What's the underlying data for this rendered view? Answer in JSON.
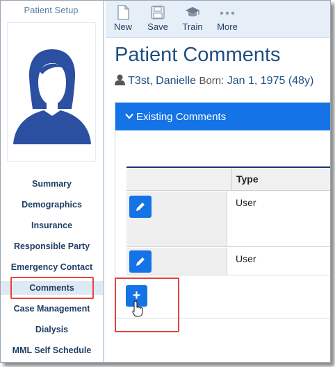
{
  "sidebar": {
    "title": "Patient Setup",
    "items": [
      {
        "label": "Summary"
      },
      {
        "label": "Demographics"
      },
      {
        "label": "Insurance"
      },
      {
        "label": "Responsible Party"
      },
      {
        "label": "Emergency Contact"
      },
      {
        "label": "Comments",
        "active": true
      },
      {
        "label": "Case Management"
      },
      {
        "label": "Dialysis"
      },
      {
        "label": "MML Self Schedule"
      }
    ]
  },
  "toolbar": {
    "new_label": "New",
    "save_label": "Save",
    "train_label": "Train",
    "more_label": "More"
  },
  "page": {
    "title": "Patient Comments"
  },
  "patient": {
    "name": "T3st, Danielle",
    "born_label": "Born:",
    "born_value": "Jan 1, 1975 (48y)"
  },
  "panel": {
    "header": "Existing Comments",
    "columns": {
      "type": "Type"
    },
    "rows": [
      {
        "type": "User"
      },
      {
        "type": "User"
      }
    ],
    "add_label": "+"
  },
  "colors": {
    "accent": "#1473e6",
    "highlight": "#e0453d",
    "nav_text": "#1f3f64",
    "title_text": "#1f4e82"
  }
}
